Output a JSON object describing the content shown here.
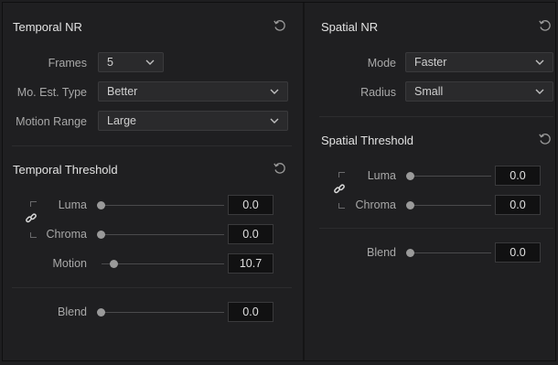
{
  "temporal_nr": {
    "title": "Temporal NR",
    "frames": {
      "label": "Frames",
      "value": "5"
    },
    "mo_est_type": {
      "label": "Mo. Est. Type",
      "value": "Better"
    },
    "motion_range": {
      "label": "Motion Range",
      "value": "Large"
    }
  },
  "temporal_threshold": {
    "title": "Temporal Threshold",
    "luma": {
      "label": "Luma",
      "value": "0.0"
    },
    "chroma": {
      "label": "Chroma",
      "value": "0.0"
    },
    "motion": {
      "label": "Motion",
      "value": "10.7"
    },
    "blend": {
      "label": "Blend",
      "value": "0.0"
    }
  },
  "spatial_nr": {
    "title": "Spatial NR",
    "mode": {
      "label": "Mode",
      "value": "Faster"
    },
    "radius": {
      "label": "Radius",
      "value": "Small"
    }
  },
  "spatial_threshold": {
    "title": "Spatial Threshold",
    "luma": {
      "label": "Luma",
      "value": "0.0"
    },
    "chroma": {
      "label": "Chroma",
      "value": "0.0"
    },
    "blend": {
      "label": "Blend",
      "value": "0.0"
    }
  },
  "icons": {
    "reset": "reset-icon",
    "chevron": "chevron-down-icon",
    "link": "link-icon"
  },
  "colors": {
    "panel_bg": "#1f1f21",
    "field_bg": "#2a2a2c",
    "number_bg": "#111112",
    "text": "#c8c8c8"
  }
}
